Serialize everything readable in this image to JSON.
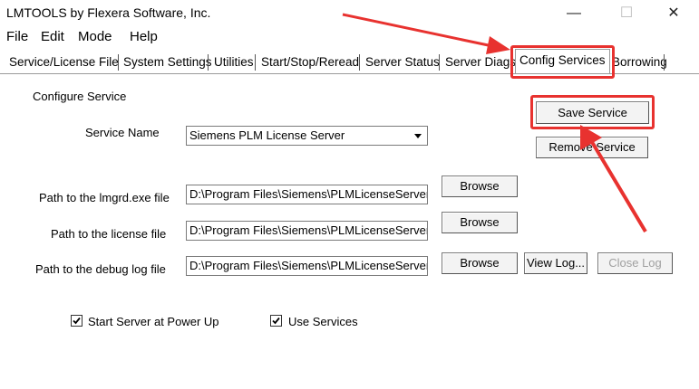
{
  "window": {
    "title": "LMTOOLS by Flexera Software, Inc.",
    "controls": [
      "—",
      "☐",
      "✕"
    ]
  },
  "menu": [
    "File",
    "Edit",
    "Mode",
    "Help"
  ],
  "tabs": [
    {
      "label": "Service/License File"
    },
    {
      "label": "System Settings"
    },
    {
      "label": "Utilities"
    },
    {
      "label": "Start/Stop/Reread"
    },
    {
      "label": "Server Status"
    },
    {
      "label": "Server Diags"
    },
    {
      "label": "Config Services",
      "active": true
    },
    {
      "label": "Borrowing"
    }
  ],
  "config": {
    "section_label": "Configure Service",
    "service_name_label": "Service Name",
    "service_name_value": "Siemens PLM License Server",
    "lmgrd_label": "Path to the lmgrd.exe file",
    "lmgrd_value": "D:\\Program Files\\Siemens\\PLMLicenseServer\\lı",
    "license_label": "Path to the license file",
    "license_value": "D:\\Program Files\\Siemens\\PLMLicenseServer\\s",
    "debug_label": "Path to the debug log file",
    "debug_value": "D:\\Program Files\\Siemens\\PLMLicenseServer\\s",
    "browse_label": "Browse",
    "save_label": "Save Service",
    "remove_label": "Remove Service",
    "viewlog_label": "View Log...",
    "closelog_label": "Close Log",
    "start_at_powerup_label": "Start Server at Power Up",
    "start_at_powerup_checked": true,
    "use_services_label": "Use Services",
    "use_services_checked": true
  },
  "annotation_color": "#e8322f"
}
